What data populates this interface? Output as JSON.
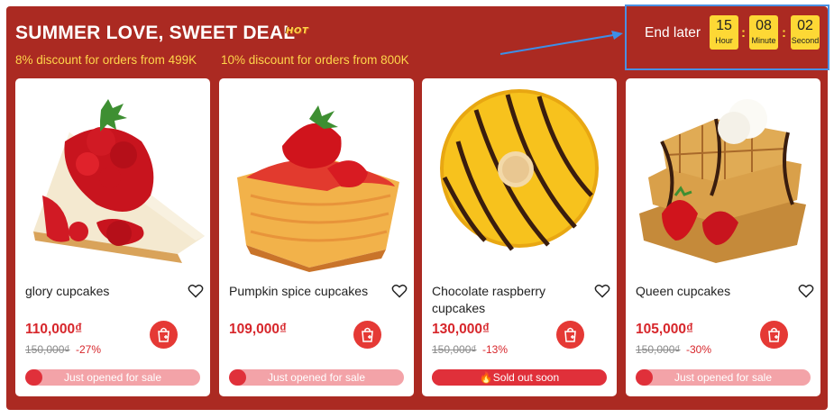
{
  "header": {
    "title": "SUMMER LOVE, SWEET DEAL",
    "hot_badge": "HOT",
    "discounts": [
      "8% discount for orders from 499K",
      "10% discount for orders from 800K"
    ]
  },
  "timer": {
    "label": "End later",
    "hour": "15",
    "hour_unit": "Hour",
    "minute": "08",
    "minute_unit": "Minute",
    "second": "02",
    "second_unit": "Second"
  },
  "products": [
    {
      "name": "glory cupcakes",
      "price": "110,000₫",
      "old_price": "150,000₫",
      "discount": "-27%",
      "status": "Just opened for sale",
      "sold_fraction": 0.1
    },
    {
      "name": "Pumpkin spice cupcakes",
      "price": "109,000₫",
      "old_price": "",
      "discount": "",
      "status": "Just opened for sale",
      "sold_fraction": 0.1
    },
    {
      "name": "Chocolate raspberry cupcakes",
      "price": "130,000₫",
      "old_price": "150,000₫",
      "discount": "-13%",
      "status": "🔥Sold out soon",
      "sold_fraction": 0.97
    },
    {
      "name": "Queen cupcakes",
      "price": "105,000₫",
      "old_price": "150,000₫",
      "discount": "-30%",
      "status": "Just opened for sale",
      "sold_fraction": 0.1
    }
  ],
  "colors": {
    "panel": "#ab2a22",
    "accent_yellow": "#ffd54a",
    "price_red": "#d7262b",
    "highlight_blue": "#4a90e2"
  }
}
